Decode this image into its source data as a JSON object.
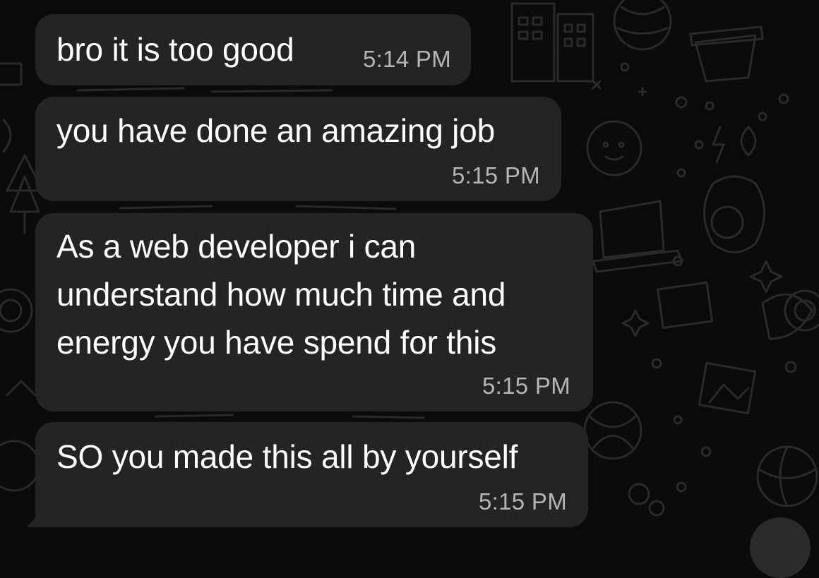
{
  "colors": {
    "background": "#0b0b0b",
    "bubble": "#242424",
    "text": "#ffffff",
    "timestamp": "#b5b5b5",
    "doodle": "#2a2a2a"
  },
  "messages": [
    {
      "text": "bro it is too good",
      "time": "5:14 PM"
    },
    {
      "text": "you have done an amazing job",
      "time": "5:15 PM"
    },
    {
      "text": "As a web developer i can\nunderstand how much time and\nenergy you have spend for this",
      "time": "5:15 PM"
    },
    {
      "text": "SO you made this all by yourself",
      "time": "5:15 PM"
    }
  ]
}
